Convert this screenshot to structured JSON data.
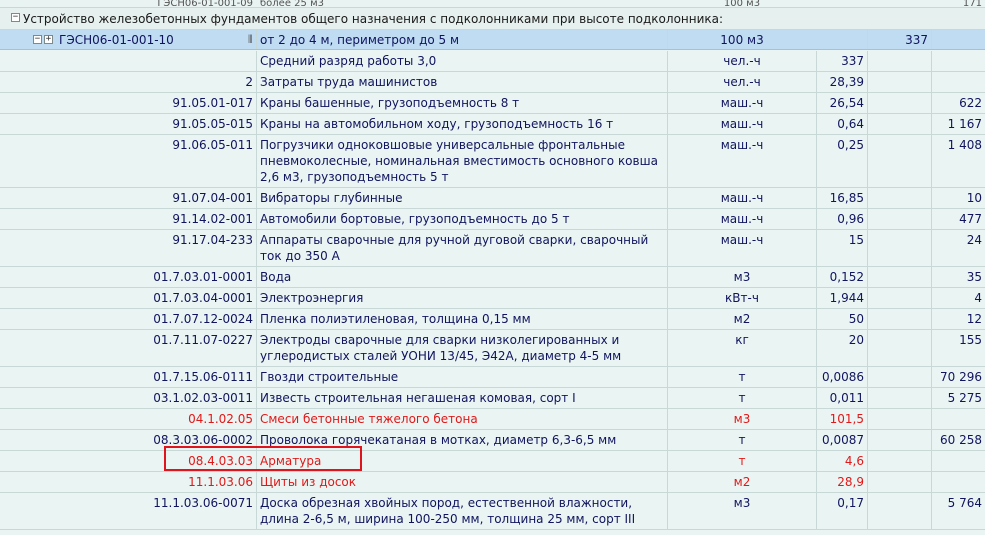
{
  "top_row": {
    "code": "ГЭСН06-01-001-09",
    "name": "более 25 м3",
    "unit": "100 м3",
    "sum": "171"
  },
  "section": {
    "title": "Устройство железобетонных фундаментов общего назначения с подколонниками при высоте подколонника:"
  },
  "gesn_row": {
    "code": "ГЭСН06-01-001-10",
    "name": "от 2 до 4 м, периметром до 5 м",
    "unit": "100 м3",
    "qty": "337"
  },
  "rows": [
    {
      "code": "",
      "name": "Средний разряд работы 3,0",
      "unit": "чел.-ч",
      "qty": "337",
      "sum": ""
    },
    {
      "code": "2",
      "name": "Затраты труда машинистов",
      "unit": "чел.-ч",
      "qty": "28,39",
      "sum": ""
    },
    {
      "code": "91.05.01-017",
      "name": "Краны башенные, грузоподъемность 8 т",
      "unit": "маш.-ч",
      "qty": "26,54",
      "sum": "622"
    },
    {
      "code": "91.05.05-015",
      "name": "Краны на автомобильном ходу, грузоподъемность 16 т",
      "unit": "маш.-ч",
      "qty": "0,64",
      "sum": "1 167"
    },
    {
      "code": "91.06.05-011",
      "name": "Погрузчики одноковшовые универсальные фронтальные пневмоколесные, номинальная вместимость основного ковша 2,6 м3, грузоподъемность 5 т",
      "unit": "маш.-ч",
      "qty": "0,25",
      "sum": "1 408"
    },
    {
      "code": "91.07.04-001",
      "name": "Вибраторы глубинные",
      "unit": "маш.-ч",
      "qty": "16,85",
      "sum": "10"
    },
    {
      "code": "91.14.02-001",
      "name": "Автомобили бортовые, грузоподъемность до 5 т",
      "unit": "маш.-ч",
      "qty": "0,96",
      "sum": "477"
    },
    {
      "code": "91.17.04-233",
      "name": "Аппараты сварочные для ручной дуговой сварки, сварочный ток до 350 А",
      "unit": "маш.-ч",
      "qty": "15",
      "sum": "24"
    },
    {
      "code": "01.7.03.01-0001",
      "name": "Вода",
      "unit": "м3",
      "qty": "0,152",
      "sum": "35"
    },
    {
      "code": "01.7.03.04-0001",
      "name": "Электроэнергия",
      "unit": "кВт-ч",
      "qty": "1,944",
      "sum": "4"
    },
    {
      "code": "01.7.07.12-0024",
      "name": "Пленка полиэтиленовая, толщина 0,15 мм",
      "unit": "м2",
      "qty": "50",
      "sum": "12"
    },
    {
      "code": "01.7.11.07-0227",
      "name": "Электроды сварочные для сварки низколегированных и углеродистых сталей УОНИ 13/45, Э42А, диаметр 4-5 мм",
      "unit": "кг",
      "qty": "20",
      "sum": "155"
    },
    {
      "code": "01.7.15.06-0111",
      "name": "Гвозди строительные",
      "unit": "т",
      "qty": "0,0086",
      "sum": "70 296"
    },
    {
      "code": "03.1.02.03-0011",
      "name": "Известь строительная негашеная комовая, сорт I",
      "unit": "т",
      "qty": "0,011",
      "sum": "5 275"
    },
    {
      "code": "04.1.02.05",
      "name": "Смеси бетонные тяжелого бетона",
      "unit": "м3",
      "qty": "101,5",
      "sum": ""
    },
    {
      "code": "08.3.03.06-0002",
      "name": "Проволока горячекатаная в мотках, диаметр 6,3-6,5 мм",
      "unit": "т",
      "qty": "0,0087",
      "sum": "60 258"
    },
    {
      "code": "08.4.03.03",
      "name": "Арматура",
      "unit": "т",
      "qty": "4,6",
      "sum": ""
    },
    {
      "code": "11.1.03.06",
      "name": "Щиты из досок",
      "unit": "м2",
      "qty": "28,9",
      "sum": ""
    },
    {
      "code": "11.1.03.06-0071",
      "name": "Доска обрезная хвойных пород, естественной влажности, длина 2-6,5 м, ширина 100-250 мм, толщина 25 мм, сорт III",
      "unit": "м3",
      "qty": "0,17",
      "sum": "5 764"
    }
  ],
  "colors": {
    "background": "#eaf5f3",
    "selected_row": "#bfdcf3",
    "text": "#10145e",
    "red_text": "#e01818",
    "highlight_box": "#e0141c",
    "grid_line": "#c8d8d6"
  }
}
